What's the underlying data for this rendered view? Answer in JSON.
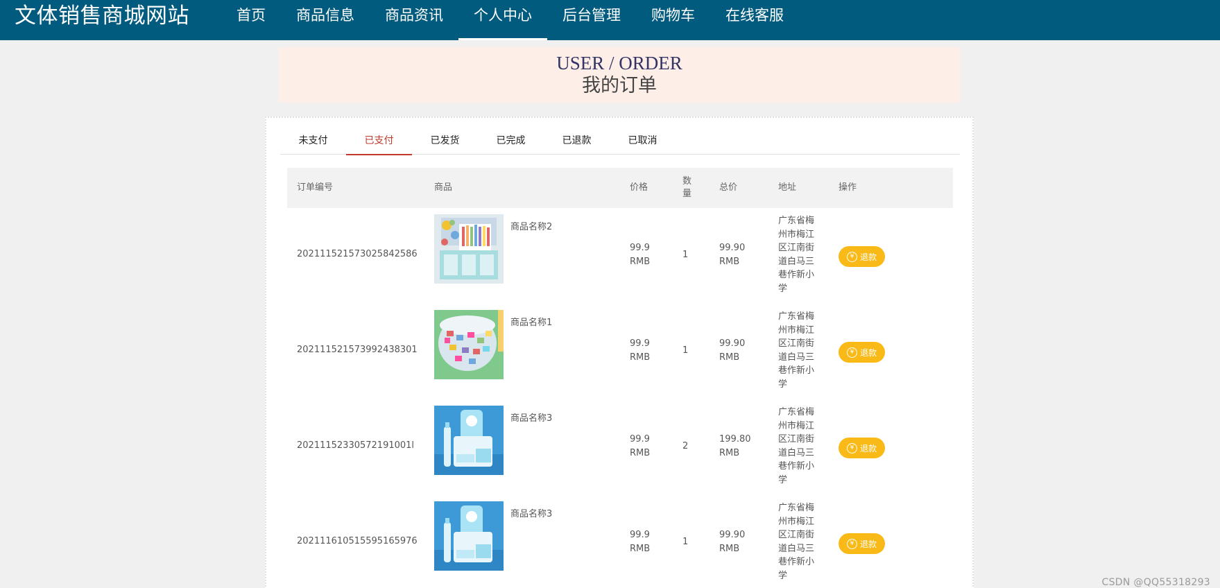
{
  "header": {
    "brand": "文体销售商城网站",
    "nav": [
      "首页",
      "商品信息",
      "商品资讯",
      "个人中心",
      "后台管理",
      "购物车",
      "在线客服"
    ],
    "active_nav": 3
  },
  "banner": {
    "en": "USER / ORDER",
    "cn": "我的订单"
  },
  "tabs": {
    "items": [
      "未支付",
      "已支付",
      "已发货",
      "已完成",
      "已退款",
      "已取消"
    ],
    "active": 1
  },
  "table": {
    "headers": {
      "id": "订单编号",
      "goods": "商品",
      "price": "价格",
      "qty": "数量",
      "total": "总价",
      "addr": "地址",
      "op": "操作"
    },
    "rows": [
      {
        "id": "202111521573025842586",
        "name": "商品名称2",
        "price": "99.9 RMB",
        "qty": "1",
        "total": "99.90 RMB",
        "addr": "广东省梅州市梅江区江南街道白马三巷作新小学",
        "action": "退款",
        "image": "pen-holder"
      },
      {
        "id": "202111521573992438301",
        "name": "商品名称1",
        "price": "99.9 RMB",
        "qty": "1",
        "total": "99.90 RMB",
        "addr": "广东省梅州市梅江区江南街道白马三巷作新小学",
        "action": "退款",
        "image": "binder-clips"
      },
      {
        "id": "20211152330572191001l",
        "name": "商品名称3",
        "price": "99.9 RMB",
        "qty": "2",
        "total": "199.80 RMB",
        "addr": "广东省梅州市梅江区江南街道白马三巷作新小学",
        "action": "退款",
        "image": "blue-stationery"
      },
      {
        "id": "202111610515595165976",
        "name": "商品名称3",
        "price": "99.9 RMB",
        "qty": "1",
        "total": "99.90 RMB",
        "addr": "广东省梅州市梅江区江南街道白马三巷作新小学",
        "action": "退款",
        "image": "blue-stationery"
      }
    ]
  },
  "icons": {
    "refund": "yen-circle-icon"
  },
  "colors": {
    "header": "#015b7e",
    "banner": "#fdeee8",
    "accent": "#c0392b",
    "button": "#f9b916"
  },
  "watermark": "CSDN @QQ55318293"
}
